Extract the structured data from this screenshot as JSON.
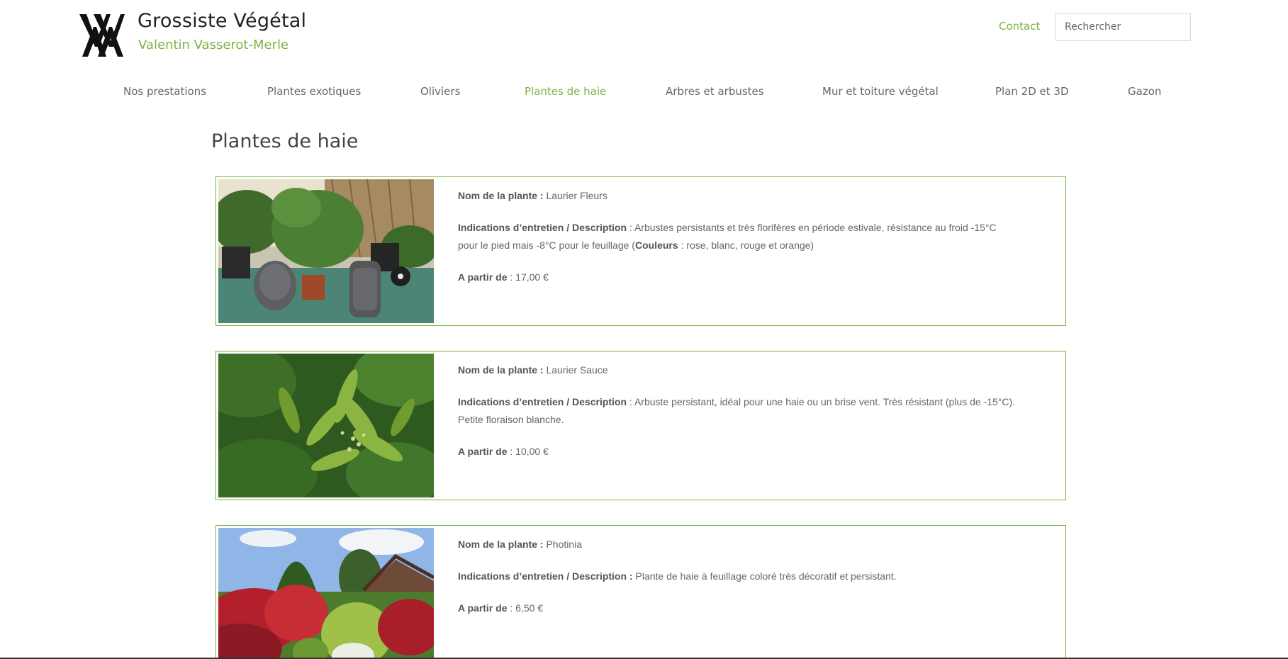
{
  "brand": {
    "title": "Grossiste Végétal",
    "subtitle": "Valentin Vasserot-Merle",
    "logo_icon": "vvm-monogram-icon"
  },
  "header": {
    "contact_label": "Contact",
    "search_placeholder": "Rechercher",
    "search_value": ""
  },
  "nav": {
    "items": [
      {
        "label": "Nos prestations"
      },
      {
        "label": "Plantes exotiques"
      },
      {
        "label": "Oliviers"
      },
      {
        "label": "Plantes de haie"
      },
      {
        "label": "Arbres et arbustes"
      },
      {
        "label": "Mur et toiture végétal"
      },
      {
        "label": "Plan 2D et 3D"
      },
      {
        "label": "Gazon"
      }
    ],
    "active_label": "Plantes de haie"
  },
  "page": {
    "title": "Plantes de haie"
  },
  "labels": {
    "name": "Nom de la plante :",
    "description": "Indications d’entretien / Description",
    "price": "A partir de"
  },
  "products": [
    {
      "name": "Laurier Fleurs",
      "desc_sep": " : ",
      "description": "Arbustes persistants et très florifères en période estivale, résistance au froid -15°C pour le pied mais -8°C pour le feuillage (",
      "colors_label": "Couleurs",
      "colors_text": " : rose, blanc, rouge et orange)",
      "price": "17,00 €",
      "image": "laurier-fleurs-photo"
    },
    {
      "name": "Laurier Sauce",
      "desc_sep": " : ",
      "description": "Arbuste persistant, idéal pour une haie ou un brise vent. Très résistant (plus de -15°C). Petite floraison blanche.",
      "price": "10,00 €",
      "image": "laurier-sauce-photo"
    },
    {
      "name": "Photinia",
      "desc_sep": " : ",
      "description": "Plante de haie à feuillage coloré très décoratif et persistant.",
      "price": "6,50 €",
      "image": "photinia-photo"
    }
  ],
  "colors": {
    "accent": "#7ab341",
    "text": "#666666",
    "title": "#444444"
  }
}
